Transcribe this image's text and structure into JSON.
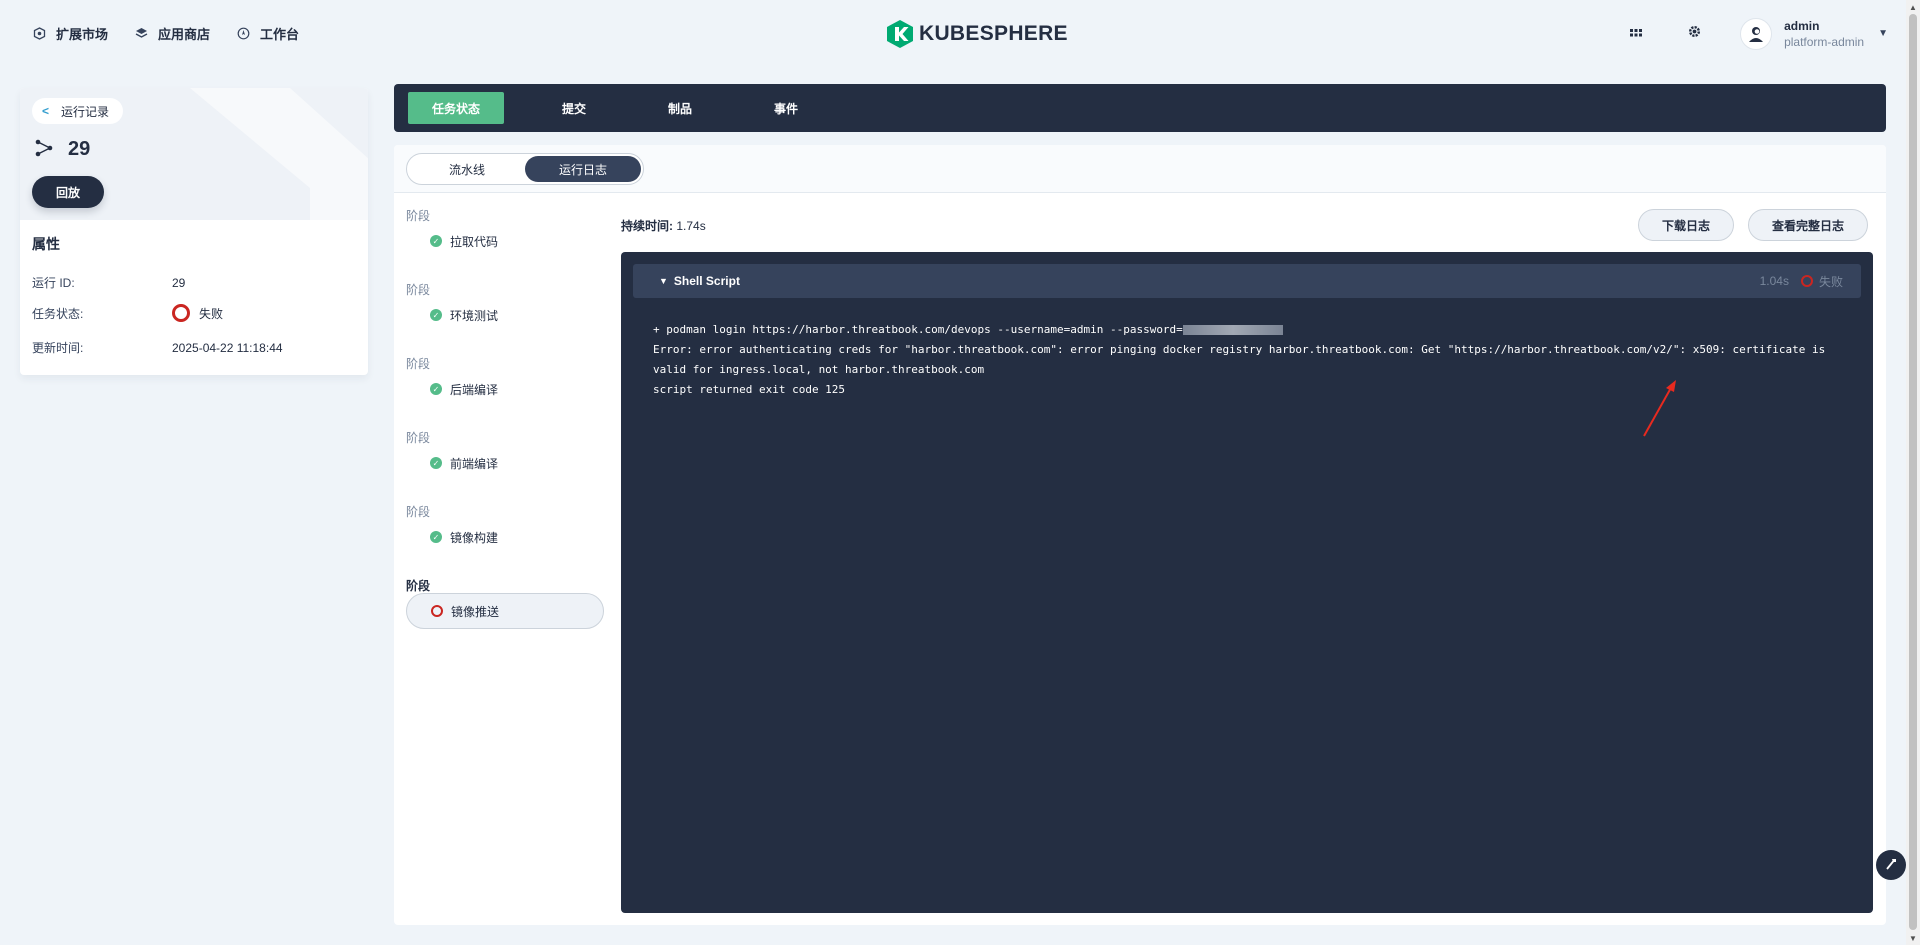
{
  "topnav": {
    "items": [
      {
        "label": "扩展市场",
        "icon": "extension-icon"
      },
      {
        "label": "应用商店",
        "icon": "app-store-icon"
      },
      {
        "label": "工作台",
        "icon": "workbench-icon"
      }
    ],
    "logo_text": "KUBESPHERE",
    "user_name": "admin",
    "user_role": "platform-admin"
  },
  "left": {
    "back_label": "运行记录",
    "run_number": "29",
    "replay_label": "回放",
    "props_title": "属性",
    "props": [
      {
        "key": "运行 ID:",
        "value": "29"
      },
      {
        "key": "任务状态:",
        "value": "失败"
      },
      {
        "key": "更新时间:",
        "value": "2025-04-22 11:18:44"
      }
    ]
  },
  "tabs": [
    "任务状态",
    "提交",
    "制品",
    "事件"
  ],
  "sub_tabs": [
    "流水线",
    "运行日志"
  ],
  "stages": [
    {
      "label": "阶段",
      "name": "拉取代码",
      "status": "success"
    },
    {
      "label": "阶段",
      "name": "环境测试",
      "status": "success"
    },
    {
      "label": "阶段",
      "name": "后端编译",
      "status": "success"
    },
    {
      "label": "阶段",
      "name": "前端编译",
      "status": "success"
    },
    {
      "label": "阶段",
      "name": "镜像构建",
      "status": "success"
    },
    {
      "label": "阶段",
      "name": "镜像推送",
      "status": "failed"
    }
  ],
  "log": {
    "duration_label": "持续时间:",
    "duration_value": "1.74s",
    "download_label": "下载日志",
    "view_full_label": "查看完整日志",
    "step_title": "Shell Script",
    "step_time": "1.04s",
    "step_status": "失败",
    "line1": "+ podman login https://harbor.threatbook.com/devops --username=admin --password=",
    "line2": "Error: error authenticating creds for \"harbor.threatbook.com\": error pinging docker registry harbor.threatbook.com: Get \"https://harbor.threatbook.com/v2/\": x509: certificate is valid for ingress.local, not harbor.threatbook.com",
    "line3": "script returned exit code 125"
  },
  "colors": {
    "dark": "#242e42",
    "success": "#55bc8a",
    "danger": "#ca2621",
    "background": "#eff4f9"
  }
}
